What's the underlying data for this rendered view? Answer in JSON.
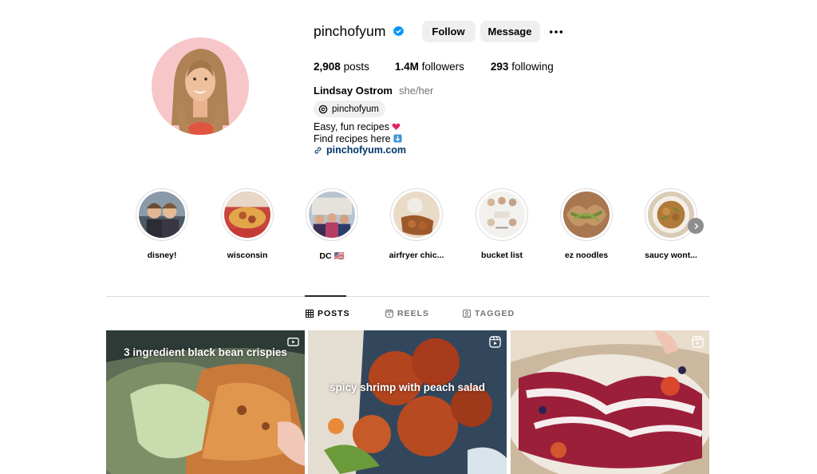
{
  "profile": {
    "username": "pinchofyum",
    "verified": true,
    "follow_label": "Follow",
    "message_label": "Message",
    "posts_count": "2,908",
    "posts_label": "posts",
    "followers_count": "1.4M",
    "followers_label": "followers",
    "following_count": "293",
    "following_label": "following",
    "full_name": "Lindsay Ostrom",
    "pronouns": "she/her",
    "threads_handle": "pinchofyum",
    "bio_line1": "Easy, fun recipes",
    "bio_line2": "Find recipes here",
    "website": "pinchofyum.com"
  },
  "highlights": [
    {
      "label": "disney!",
      "icon": "highlight-cover"
    },
    {
      "label": "wisconsin",
      "icon": "highlight-cover"
    },
    {
      "label": "DC 🇺🇸",
      "icon": "highlight-cover"
    },
    {
      "label": "airfryer chic...",
      "icon": "highlight-cover"
    },
    {
      "label": "bucket list",
      "icon": "highlight-cover"
    },
    {
      "label": "ez noodles",
      "icon": "highlight-cover"
    },
    {
      "label": "saucy wont...",
      "icon": "highlight-cover"
    }
  ],
  "tabs": [
    {
      "label": "POSTS",
      "icon": "grid-icon",
      "active": true
    },
    {
      "label": "REELS",
      "icon": "reels-icon",
      "active": false
    },
    {
      "label": "TAGGED",
      "icon": "tagged-icon",
      "active": false
    }
  ],
  "posts": [
    {
      "caption": "3 ingredient black bean crispies",
      "icon": "video-icon"
    },
    {
      "caption": "spicy shrimp with peach salad",
      "icon": "reels-icon"
    },
    {
      "caption": "",
      "icon": "reels-icon"
    }
  ],
  "colors": {
    "link": "#00376b",
    "verified_badge": "#0095f6",
    "button_bg": "#efefef",
    "muted_text": "#737373"
  }
}
